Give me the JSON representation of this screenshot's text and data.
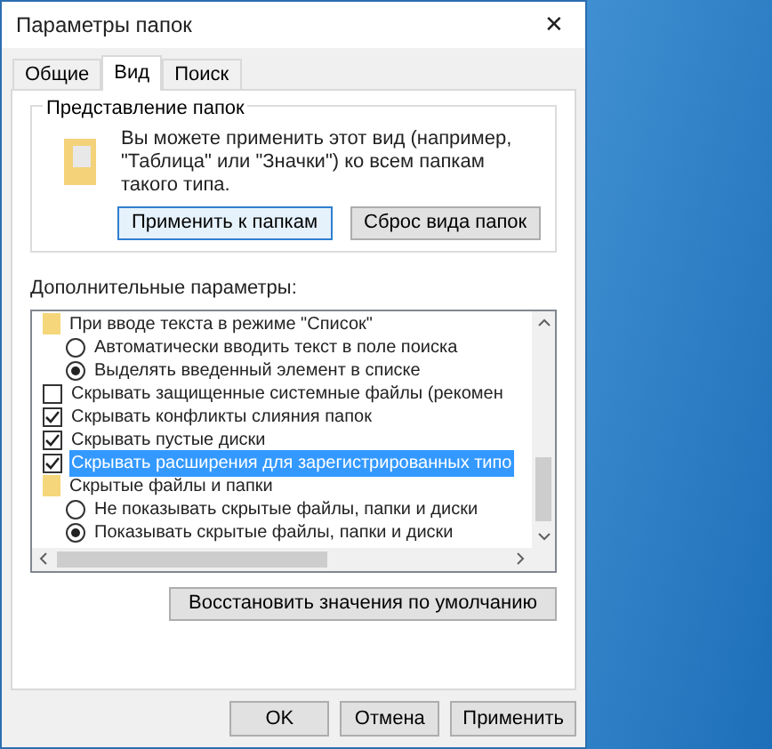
{
  "window": {
    "title": "Параметры папок",
    "close": "✕"
  },
  "tabs": [
    {
      "label": "Общие",
      "selected": false
    },
    {
      "label": "Вид",
      "selected": true
    },
    {
      "label": "Поиск",
      "selected": false
    }
  ],
  "folder_views": {
    "title": "Представление папок",
    "description": "Вы можете применить этот вид (например, \"Таблица\" или \"Значки\") ко всем папкам такого типа.",
    "buttons": [
      {
        "label": "Применить к папкам",
        "focused": true
      },
      {
        "label": "Сброс вида папок",
        "focused": false
      }
    ]
  },
  "advanced": {
    "title": "Дополнительные параметры:",
    "items": [
      {
        "kind": "folder",
        "label": "При вводе текста в режиме \"Список\"",
        "selected": false,
        "children": [
          {
            "kind": "radio",
            "label": "Автоматически вводить текст в поле поиска",
            "checked": false,
            "selected": false
          },
          {
            "kind": "radio",
            "label": "Выделять введенный элемент в списке",
            "checked": true,
            "selected": false
          }
        ]
      },
      {
        "kind": "checkbox",
        "label": "Скрывать защищенные системные файлы (рекомен",
        "checked": false,
        "selected": false
      },
      {
        "kind": "checkbox",
        "label": "Скрывать конфликты слияния папок",
        "checked": true,
        "selected": false
      },
      {
        "kind": "checkbox",
        "label": "Скрывать пустые диски",
        "checked": true,
        "selected": false
      },
      {
        "kind": "checkbox",
        "label": "Скрывать расширения для зарегистрированных типо",
        "checked": true,
        "selected": true
      },
      {
        "kind": "folder",
        "label": "Скрытые файлы и папки",
        "selected": false,
        "children": [
          {
            "kind": "radio",
            "label": "Не показывать скрытые файлы, папки и диски",
            "checked": false,
            "selected": false
          },
          {
            "kind": "radio",
            "label": "Показывать скрытые файлы, папки и диски",
            "checked": true,
            "selected": false
          }
        ]
      }
    ],
    "restore": "Восстановить значения по умолчанию"
  },
  "buttons": [
    {
      "label": "OK"
    },
    {
      "label": "Отмена"
    },
    {
      "label": "Применить"
    }
  ]
}
